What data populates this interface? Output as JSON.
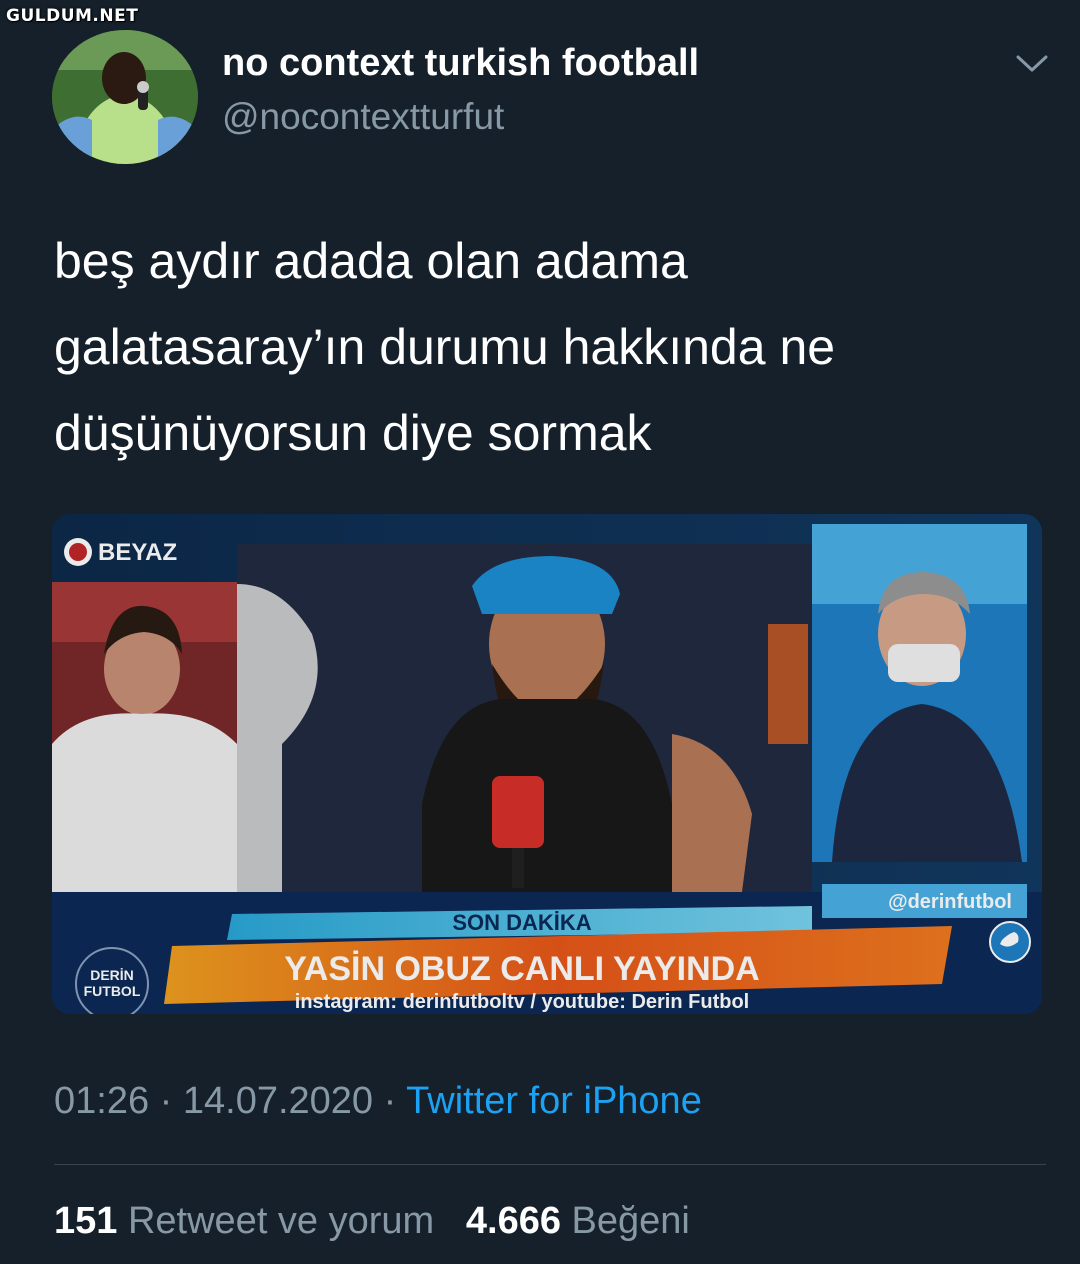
{
  "watermark": "GULDUM.NET",
  "tweet": {
    "display_name": "no context turkish football",
    "handle": "@nocontextturfut",
    "text_lines": [
      "beş aydır adada olan adama",
      "galatasaray’ın durumu hakkında ne",
      "düşünüyorsun diye sormak"
    ],
    "timestamp": "01:26 · 14.07.2020 · ",
    "source": "Twitter for iPhone",
    "retweet_count": "151",
    "retweet_label": "Retweet ve yorum",
    "like_count": "4.666",
    "like_label": "Beğeni"
  },
  "media": {
    "channel_logo": "BEYAZ",
    "breaking_label": "SON DAKİKA",
    "headline": "YASİN OBUZ CANLI YAYINDA",
    "subline": "instagram: derinfutboltv / youtube: Derin Futbol",
    "social_handle": "@derinfutbol",
    "show_logo_line1": "DERİN",
    "show_logo_line2": "FUTBOL"
  },
  "icons": {
    "menu": "chevron-down-icon",
    "twitter": "twitter-bird-icon"
  },
  "colors": {
    "background": "#15202b",
    "secondary_text": "#8899a6",
    "link": "#1da1f2",
    "ticker_orange": "#e8571a"
  }
}
